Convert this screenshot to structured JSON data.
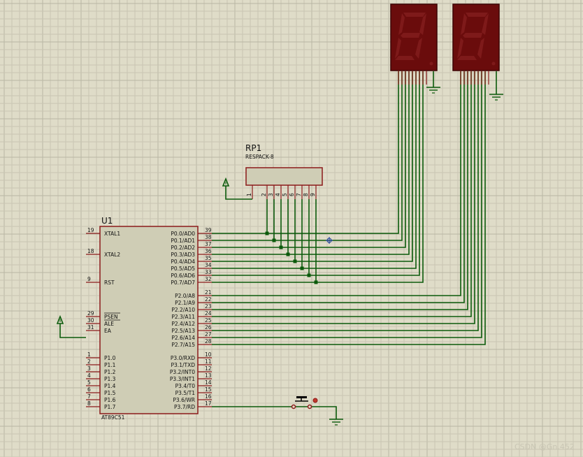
{
  "u1": {
    "ref": "U1",
    "part": "AT89C51",
    "left_pins": [
      {
        "num": "19",
        "label": "XTAL1"
      },
      {
        "num": "18",
        "label": "XTAL2"
      },
      {
        "num": "9",
        "label": "RST"
      },
      {
        "num": "29",
        "label": "PSEN"
      },
      {
        "num": "30",
        "label": "ALE"
      },
      {
        "num": "31",
        "label": "EA"
      },
      {
        "num": "1",
        "label": "P1.0"
      },
      {
        "num": "2",
        "label": "P1.1"
      },
      {
        "num": "3",
        "label": "P1.2"
      },
      {
        "num": "4",
        "label": "P1.3"
      },
      {
        "num": "5",
        "label": "P1.4"
      },
      {
        "num": "6",
        "label": "P1.5"
      },
      {
        "num": "7",
        "label": "P1.6"
      },
      {
        "num": "8",
        "label": "P1.7"
      }
    ],
    "right_pins": [
      {
        "num": "39",
        "label": "P0.0/AD0"
      },
      {
        "num": "38",
        "label": "P0.1/AD1"
      },
      {
        "num": "37",
        "label": "P0.2/AD2"
      },
      {
        "num": "36",
        "label": "P0.3/AD3"
      },
      {
        "num": "35",
        "label": "P0.4/AD4"
      },
      {
        "num": "34",
        "label": "P0.5/AD5"
      },
      {
        "num": "33",
        "label": "P0.6/AD6"
      },
      {
        "num": "32",
        "label": "P0.7/AD7"
      },
      {
        "num": "21",
        "label": "P2.0/A8"
      },
      {
        "num": "22",
        "label": "P2.1/A9"
      },
      {
        "num": "23",
        "label": "P2.2/A10"
      },
      {
        "num": "24",
        "label": "P2.3/A11"
      },
      {
        "num": "25",
        "label": "P2.4/A12"
      },
      {
        "num": "26",
        "label": "P2.5/A13"
      },
      {
        "num": "27",
        "label": "P2.6/A14"
      },
      {
        "num": "28",
        "label": "P2.7/A15"
      },
      {
        "num": "10",
        "label": "P3.0/RXD"
      },
      {
        "num": "11",
        "label": "P3.1/TXD"
      },
      {
        "num": "12",
        "label": "P3.2/INT0"
      },
      {
        "num": "13",
        "label": "P3.3/INT1"
      },
      {
        "num": "14",
        "label": "P3.4/T0"
      },
      {
        "num": "15",
        "label": "P3.5/T1"
      },
      {
        "num": "16",
        "label": "P3.6/WR"
      },
      {
        "num": "17",
        "label": "P3.7/RD"
      }
    ]
  },
  "rp1": {
    "ref": "RP1",
    "part": "RESPACK-8",
    "pins": [
      "1",
      "2",
      "3",
      "4",
      "5",
      "6",
      "7",
      "8",
      "9"
    ]
  },
  "displays": [
    {
      "digit": "8"
    },
    {
      "digit": "8"
    }
  ],
  "watermark": "CSDN @Gn.452",
  "colors": {
    "background": "#dfdcc8",
    "grid": "#c8c5b2",
    "grid_major": "#b9b6a4",
    "wire": "#0b5a0b",
    "component_border": "#8b1a1a",
    "chip_fill": "#cfcdb5",
    "display_body": "#6a0c0c",
    "display_segment": "#7e1a1a",
    "pin_red": "#8b1a1a"
  }
}
